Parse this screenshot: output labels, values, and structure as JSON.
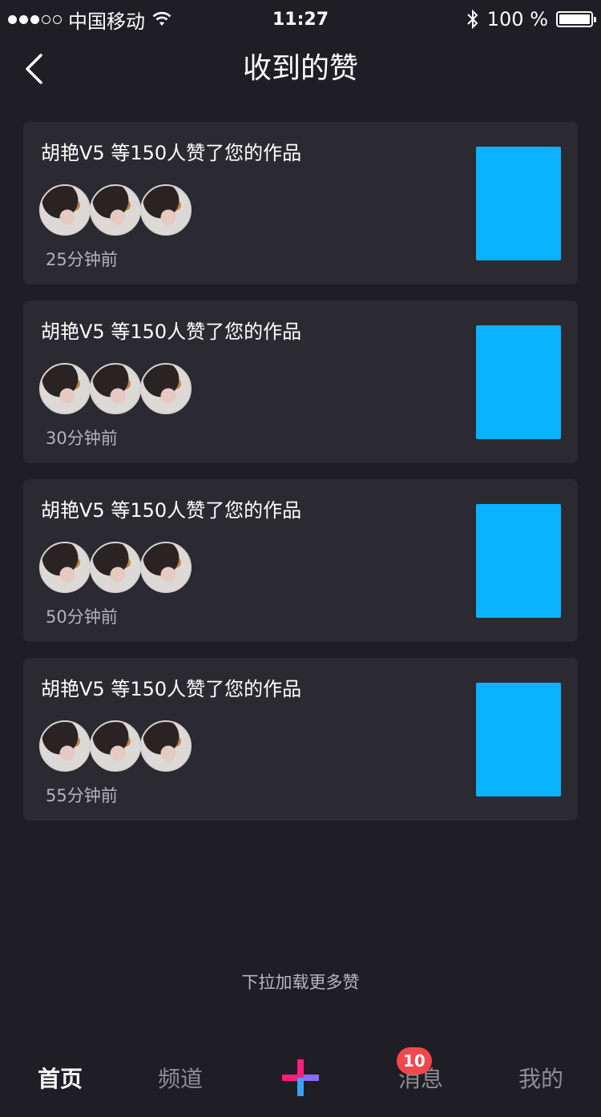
{
  "status_bar": {
    "carrier": "中国移动",
    "time": "11:27",
    "battery": "100 %"
  },
  "nav": {
    "title": "收到的赞",
    "back_icon": "chevron-left-icon"
  },
  "cards": [
    {
      "text": "胡艳V5 等150人赞了您的作品",
      "time": "25分钟前"
    },
    {
      "text": "胡艳V5 等150人赞了您的作品",
      "time": "30分钟前"
    },
    {
      "text": "胡艳V5 等150人赞了您的作品",
      "time": "50分钟前"
    },
    {
      "text": "胡艳V5 等150人赞了您的作品",
      "time": "55分钟前"
    }
  ],
  "load_more": "下拉加载更多赞",
  "tabs": [
    {
      "label": "首页"
    },
    {
      "label": "频道"
    },
    {
      "label": "",
      "icon": "plus-icon"
    },
    {
      "label": "消息",
      "badge": "10"
    },
    {
      "label": "我的"
    }
  ],
  "colors": {
    "background": "#1f1e24",
    "card": "#2b2a31",
    "thumbnail": "#0ab2ff",
    "badge": "#f2474d"
  }
}
